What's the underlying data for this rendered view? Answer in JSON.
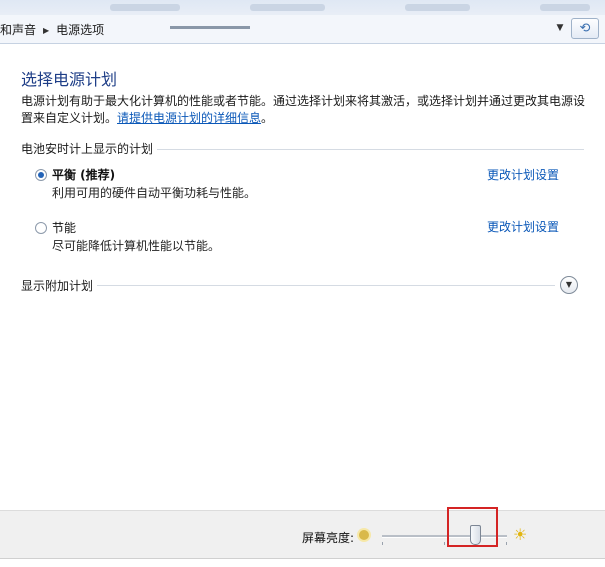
{
  "address_bar": {
    "crumbs": [
      "和声音",
      "电源选项"
    ],
    "icons": {
      "dropdown": "chevron-down-icon",
      "refresh": "refresh-icon",
      "separator": "triangle-right-icon"
    }
  },
  "page": {
    "title": "选择电源计划",
    "description": "电源计划有助于最大化计算机的性能或者节能。通过选择计划来将其激活，或选择计划并通过更改其电源设置来自定义计划。",
    "help_link": "请提供电源计划的详细信息",
    "description_end": "。"
  },
  "battery_group": {
    "label": "电池安时计上显示的计划",
    "plans": [
      {
        "name": "平衡 (推荐)",
        "description": "利用可用的硬件自动平衡功耗与性能。",
        "selected": true,
        "change_link": "更改计划设置"
      },
      {
        "name": "节能",
        "description": "尽可能降低计算机性能以节能。",
        "selected": false,
        "change_link": "更改计划设置"
      }
    ]
  },
  "additional_plans": {
    "label": "显示附加计划",
    "expanded": false,
    "icon": "chevron-down-circle-icon"
  },
  "brightness": {
    "label": "屏幕亮度:",
    "dim_icon": "brightness-low-icon",
    "bright_icon": "brightness-high-icon",
    "level": 0.75,
    "highlight_color": "#d42424"
  },
  "colors": {
    "title": "#1e3e87",
    "link": "#0b58b8",
    "radio_fill": "#2464b8"
  }
}
